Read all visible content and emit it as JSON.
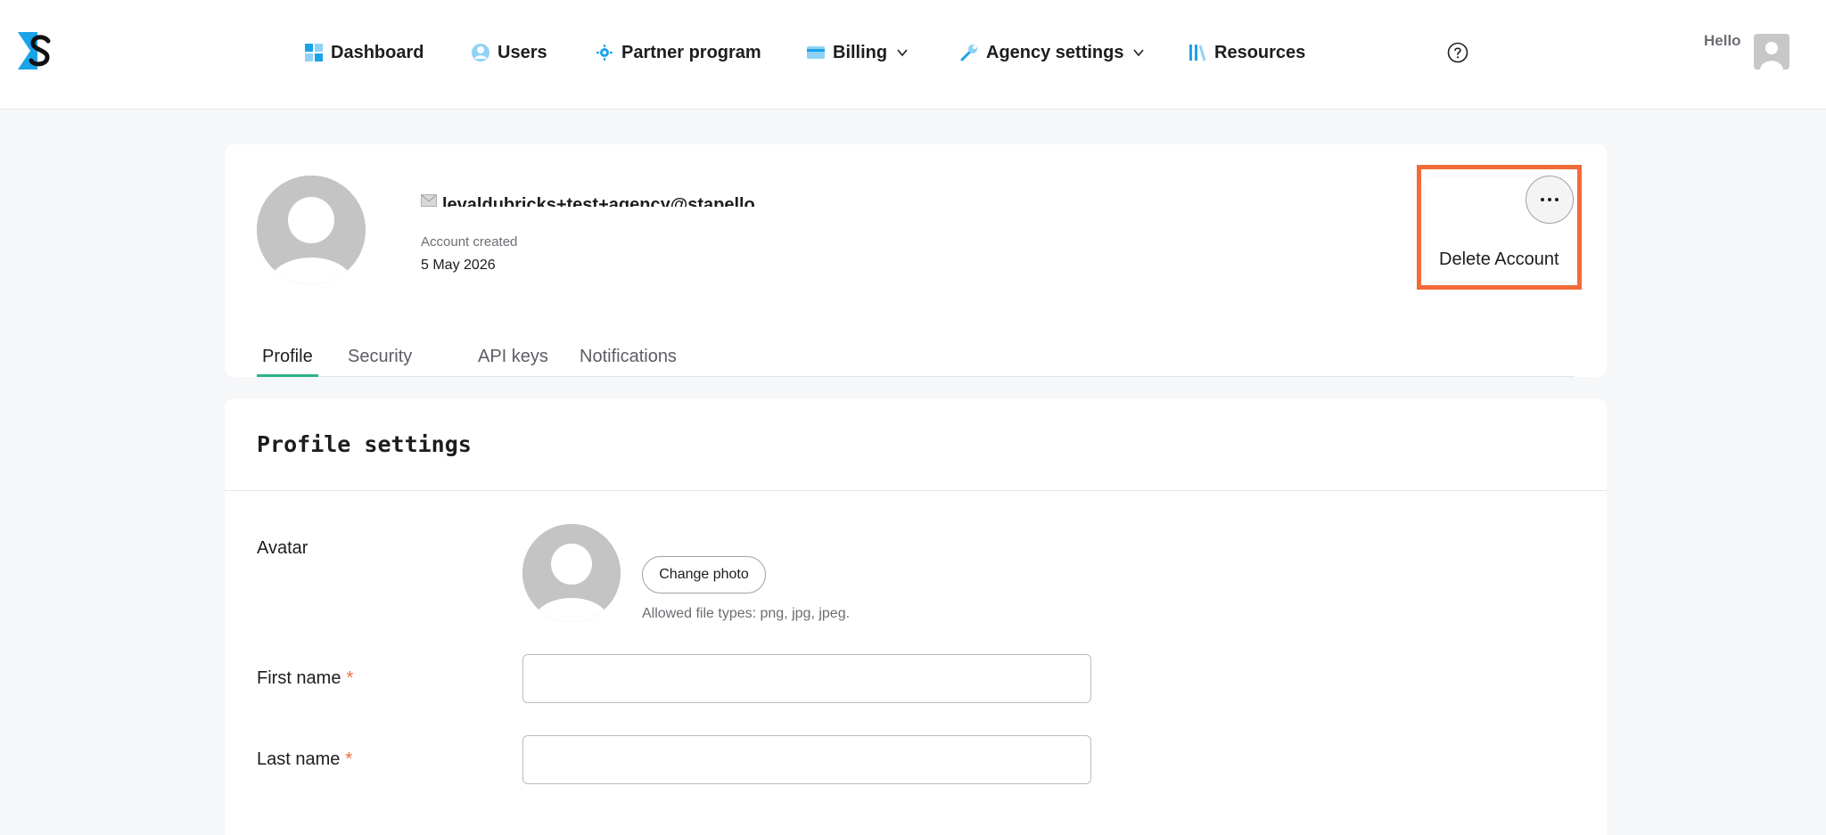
{
  "nav": {
    "dashboard": "Dashboard",
    "users": "Users",
    "partner_program": "Partner program",
    "billing": "Billing",
    "agency_settings": "Agency settings",
    "resources": "Resources",
    "hello": "Hello"
  },
  "profile_header": {
    "email": "levaldubricks+test+agency@stapello",
    "account_created_label": "Account created",
    "account_created_date": "5 May 2026",
    "tabs": [
      "Profile",
      "Security",
      "API keys",
      "Notifications"
    ],
    "active_tab": "Profile",
    "menu": {
      "delete_account": "Delete Account"
    }
  },
  "profile_settings": {
    "title": "Profile settings",
    "avatar_label": "Avatar",
    "change_photo": "Change photo",
    "file_hint": "Allowed file types: png, jpg, jpeg.",
    "first_name_label": "First name",
    "last_name_label": "Last name",
    "required_mark": "*",
    "first_name_value": "",
    "last_name_value": ""
  },
  "colors": {
    "accent_tab": "#2bb38a",
    "required": "#f26b38",
    "highlight": "#f26b38",
    "brand_blue": "#1aa3e8"
  },
  "icons": [
    "logo-icon",
    "dashboard-icon",
    "users-icon",
    "partner-icon",
    "billing-icon",
    "wrench-icon",
    "resources-icon",
    "help-icon",
    "mail-icon",
    "more-icon",
    "chevron-down-icon"
  ]
}
